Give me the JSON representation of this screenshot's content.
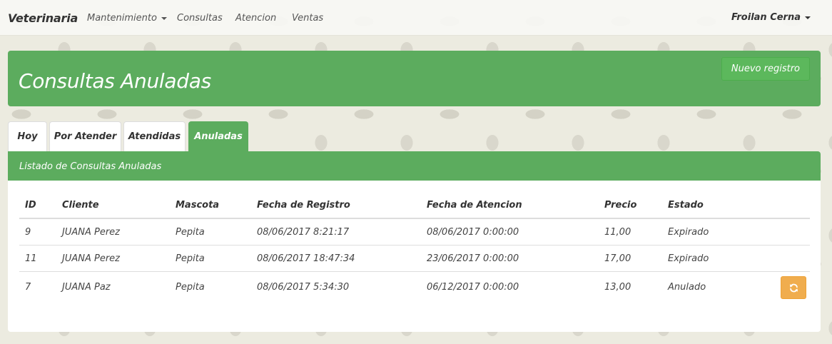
{
  "navbar": {
    "brand": "Veterinaria",
    "links": [
      "Mantenimiento",
      "Consultas",
      "Atencion",
      "Ventas"
    ],
    "user": "Froilan Cerna"
  },
  "header": {
    "title": "Consultas Anuladas",
    "new_button": "Nuevo registro"
  },
  "tabs": [
    {
      "label": "Hoy",
      "active": false
    },
    {
      "label": "Por Atender",
      "active": false
    },
    {
      "label": "Atendidas",
      "active": false
    },
    {
      "label": "Anuladas",
      "active": true
    }
  ],
  "list": {
    "heading": "Listado de Consultas Anuladas",
    "columns": [
      "ID",
      "Cliente",
      "Mascota",
      "Fecha de Registro",
      "Fecha de Atencion",
      "Precio",
      "Estado"
    ],
    "rows": [
      [
        "9",
        "JUANA Perez",
        "Pepita",
        "08/06/2017 8:21:17",
        "08/06/2017 0:00:00",
        "11,00",
        "Expirado"
      ],
      [
        "11",
        "JUANA Perez",
        "Pepita",
        "08/06/2017 18:47:34",
        "23/06/2017 0:00:00",
        "17,00",
        "Expirado"
      ],
      [
        "7",
        "JUANA Paz",
        "Pepita",
        "08/06/2017 5:34:30",
        "06/12/2017 0:00:00",
        "13,00",
        "Anulado"
      ]
    ],
    "row_actions": [
      "",
      "",
      "refresh-icon"
    ]
  },
  "colors": {
    "primary_green": "#5cac5e",
    "warning_orange": "#f0ad4e"
  }
}
